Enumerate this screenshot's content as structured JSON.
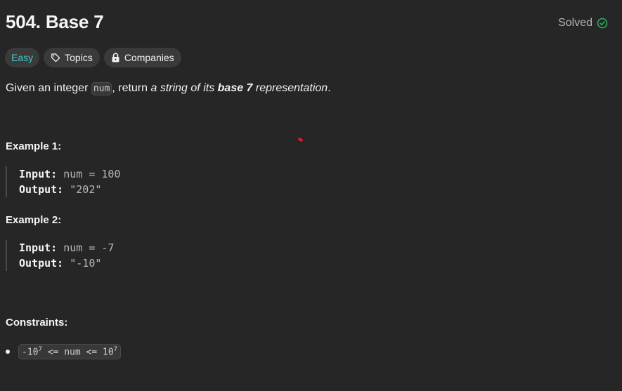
{
  "problem": {
    "title": "504. Base 7",
    "status": "Solved",
    "difficulty": "Easy",
    "tags": [
      "Topics",
      "Companies"
    ],
    "description": {
      "prefix": "Given an integer ",
      "code": "num",
      "middle": ", return ",
      "italic1": "a string of its ",
      "bold_italic": "base 7",
      "italic2": " representation",
      "suffix": "."
    }
  },
  "examples": [
    {
      "heading": "Example 1:",
      "input_label": "Input:",
      "input_value": "num = 100",
      "output_label": "Output:",
      "output_value": "\"202\""
    },
    {
      "heading": "Example 2:",
      "input_label": "Input:",
      "input_value": "num = -7",
      "output_label": "Output:",
      "output_value": "\"-10\""
    }
  ],
  "constraints": {
    "heading": "Constraints:",
    "items": [
      {
        "prefix": "-10",
        "sup1": "7",
        "middle": " <= num <= 10",
        "sup2": "7"
      }
    ]
  },
  "colors": {
    "background": "#262626",
    "easy": "#46c6c2",
    "solved_check": "#2db55d",
    "cursor": "#e01b24"
  }
}
